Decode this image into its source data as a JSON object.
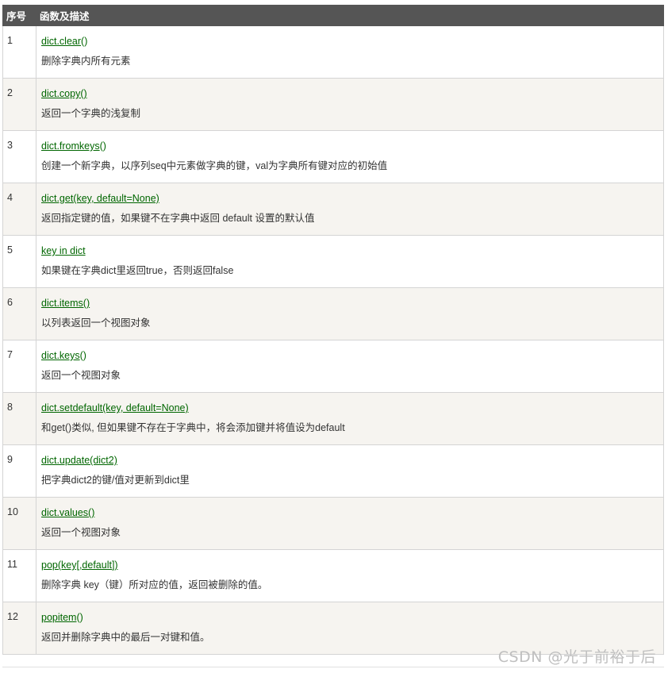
{
  "table": {
    "headers": {
      "index": "序号",
      "function": "函数及描述"
    },
    "rows": [
      {
        "index": "1",
        "link": "dict.clear",
        "suffix": "()",
        "desc": "删除字典内所有元素"
      },
      {
        "index": "2",
        "link": "dict.copy()",
        "suffix": "",
        "desc": "返回一个字典的浅复制"
      },
      {
        "index": "3",
        "link": "dict.fromkeys",
        "suffix": "()",
        "desc": "创建一个新字典，以序列seq中元素做字典的键，val为字典所有键对应的初始值"
      },
      {
        "index": "4",
        "link": "dict.get(key, default=None)",
        "suffix": "",
        "desc": "返回指定键的值，如果键不在字典中返回 default 设置的默认值"
      },
      {
        "index": "5",
        "link": "key in dict",
        "suffix": "",
        "desc": "如果键在字典dict里返回true，否则返回false"
      },
      {
        "index": "6",
        "link": "dict.items()",
        "suffix": "",
        "desc": "以列表返回一个视图对象"
      },
      {
        "index": "7",
        "link": "dict.keys",
        "suffix": "()",
        "desc": "返回一个视图对象"
      },
      {
        "index": "8",
        "link": "dict.setdefault(key, default=None)",
        "suffix": "",
        "desc": "和get()类似, 但如果键不存在于字典中，将会添加键并将值设为default"
      },
      {
        "index": "9",
        "link": "dict.update(dict2)",
        "suffix": "",
        "desc": "把字典dict2的键/值对更新到dict里"
      },
      {
        "index": "10",
        "link": "dict.values()",
        "suffix": "",
        "desc": "返回一个视图对象"
      },
      {
        "index": "11",
        "link": "pop(key[,default])",
        "suffix": "",
        "desc": "删除字典 key（键）所对应的值，返回被删除的值。"
      },
      {
        "index": "12",
        "link": "popitem",
        "suffix": "()",
        "desc": "返回并删除字典中的最后一对键和值。"
      }
    ]
  },
  "watermark": "CSDN @光于前裕于后",
  "colors": {
    "header_bg": "#555555",
    "link": "#006600",
    "row_alt_bg": "#f6f4f0",
    "border": "#d4d4d4"
  }
}
